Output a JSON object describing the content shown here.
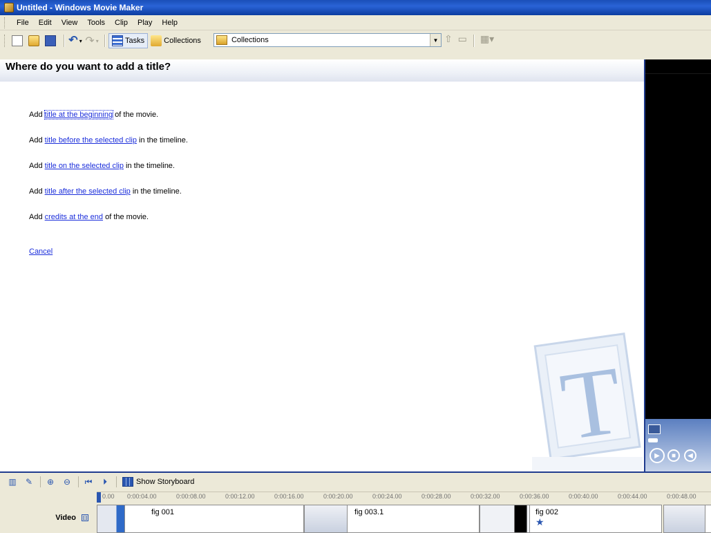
{
  "window": {
    "title": "Untitled - Windows Movie Maker"
  },
  "menu": [
    "File",
    "Edit",
    "View",
    "Tools",
    "Clip",
    "Play",
    "Help"
  ],
  "toolbar": {
    "tasks_label": "Tasks",
    "collections_label": "Collections",
    "collections_dropdown_value": "Collections"
  },
  "title_pane": {
    "heading": "Where do you want to add a title?",
    "options": [
      {
        "prefix": "Add ",
        "link": "title at the beginning",
        "suffix": " of the movie."
      },
      {
        "prefix": "Add ",
        "link": "title before the selected clip",
        "suffix": " in the timeline."
      },
      {
        "prefix": "Add ",
        "link": "title on the selected clip",
        "suffix": " in the timeline."
      },
      {
        "prefix": "Add ",
        "link": "title after the selected clip",
        "suffix": " in the timeline."
      },
      {
        "prefix": "Add ",
        "link": "credits at the end",
        "suffix": " of the movie."
      }
    ],
    "cancel": "Cancel"
  },
  "timeline": {
    "show_storyboard_label": "Show Storyboard",
    "ticks": [
      "0.00",
      "0:00:04.00",
      "0:00:08.00",
      "0:00:12.00",
      "0:00:16.00",
      "0:00:20.00",
      "0:00:24.00",
      "0:00:28.00",
      "0:00:32.00",
      "0:00:36.00",
      "0:00:40.00",
      "0:00:44.00",
      "0:00:48.00"
    ],
    "video_track_label": "Video",
    "clips": [
      {
        "name": "fig 001"
      },
      {
        "name": "fig 003.1"
      },
      {
        "name": "fig 002"
      }
    ]
  }
}
